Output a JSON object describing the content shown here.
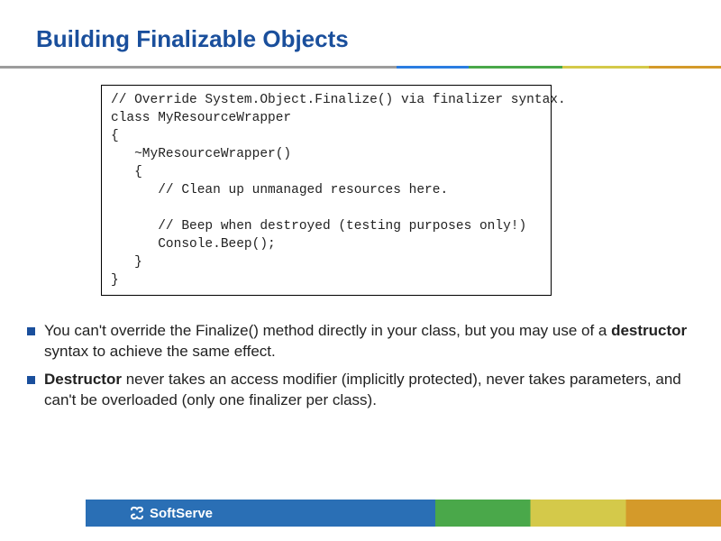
{
  "title": "Building Finalizable Objects",
  "code": {
    "l1": "// Override System.Object.Finalize() via finalizer syntax.",
    "l2": "class MyResourceWrapper",
    "l3": "{",
    "l4": "   ~MyResourceWrapper()",
    "l5": "   {",
    "l6": "      // Clean up unmanaged resources here.",
    "l7": "",
    "l8": "      // Beep when destroyed (testing purposes only!)",
    "l9": "      Console.Beep();",
    "l10": "   }",
    "l11": "}"
  },
  "bullets": {
    "b1a": "You can't override the Finalize() method directly in your class, but you may use of a ",
    "b1b": "destructor",
    "b1c": " syntax to achieve the same effect.",
    "b2a": "Destructor",
    "b2b": " never takes an access modifier (implicitly protected), never takes parameters, and can't be overloaded (only one finalizer per class)."
  },
  "footer": {
    "brand": "SoftServe"
  }
}
